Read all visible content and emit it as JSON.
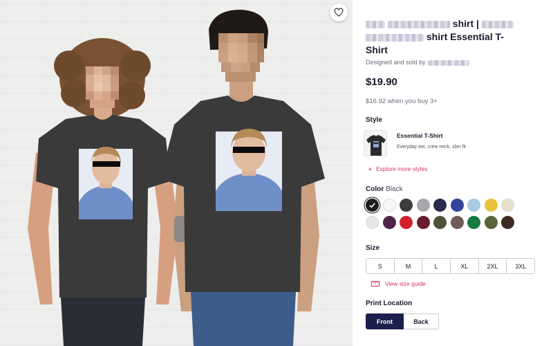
{
  "product": {
    "title_line1_suffix": "shirt |",
    "title_line2_suffix": "shirt Essential T-",
    "title_line3": "Shirt",
    "designed_by": "Designed and sold by",
    "price": "$19.90",
    "bulk_price": "$16.92 when you buy 3+"
  },
  "style": {
    "label": "Style",
    "name": "Essential T-Shirt",
    "description": "Everyday tee, crew neck, slim fit",
    "explore_label": "Explore more styles"
  },
  "color": {
    "label": "Color",
    "selected": "Black",
    "swatches": [
      "#1c1c1c",
      "#f7f7f7",
      "#3c3c3c",
      "#a8a8ac",
      "#2a2c4d",
      "#34449a",
      "#a9cbe3",
      "#e8c33a",
      "#e8e0cd",
      "#e6e6e6",
      "#4e2449",
      "#d3202c",
      "#6a1c2e",
      "#4e5138",
      "#6e5c58",
      "#167a43",
      "#5b6438",
      "#3e2a22"
    ]
  },
  "size": {
    "label": "Size",
    "options": [
      "S",
      "M",
      "L",
      "XL",
      "2XL",
      "3XL"
    ],
    "guide_label": "View size guide"
  },
  "print_location": {
    "label": "Print Location",
    "options": [
      "Front",
      "Back"
    ],
    "selected": "Front"
  },
  "colors": {
    "accent": "#d4345f",
    "navy": "#1b1f4b",
    "shirt": "#3a3a3a"
  }
}
